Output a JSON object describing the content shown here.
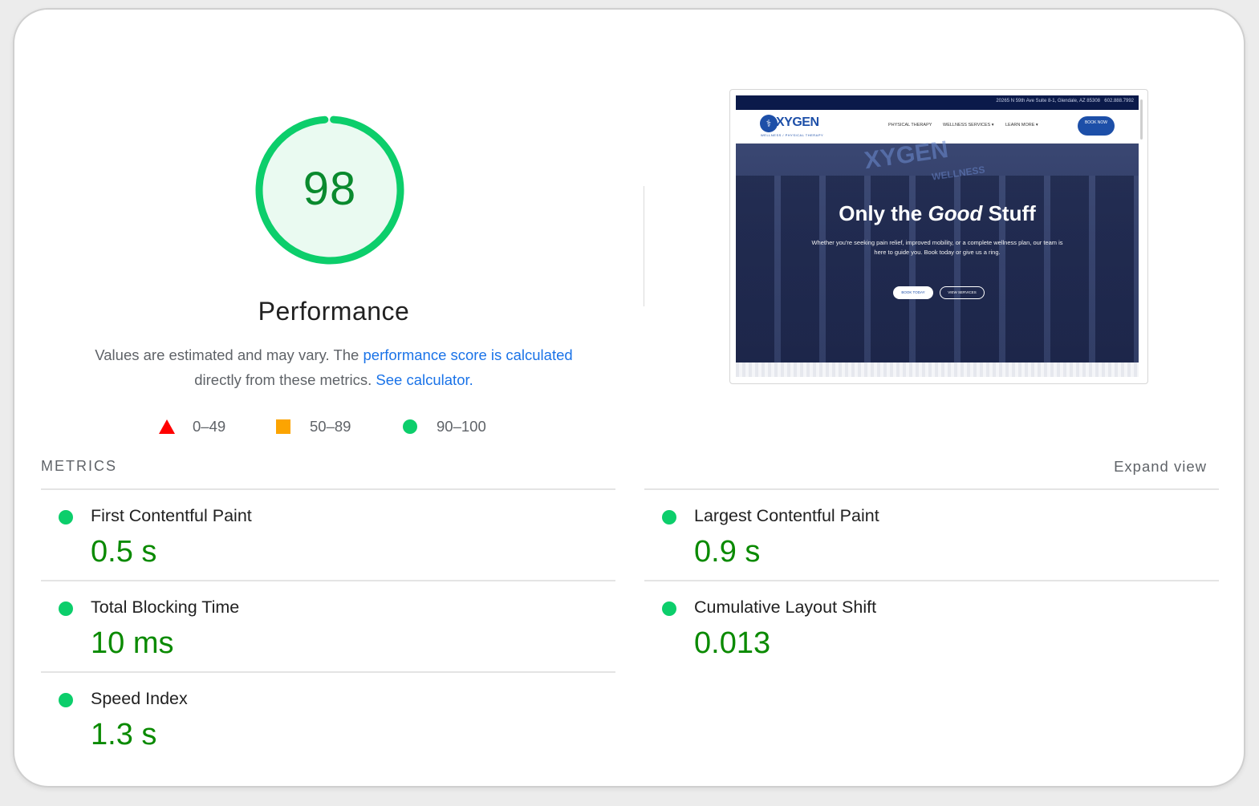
{
  "gauge": {
    "score": "98",
    "score_value": 98,
    "color": "#0cce6b"
  },
  "performance": {
    "title": "Performance",
    "desc_part1": "Values are estimated and may vary. The ",
    "desc_link1": "performance score is calculated",
    "desc_part2": " directly from these metrics. ",
    "desc_link2": "See calculator."
  },
  "legend": [
    {
      "range": "0–49",
      "shape": "triangle",
      "color": "#ff0000"
    },
    {
      "range": "50–89",
      "shape": "square",
      "color": "#fca401"
    },
    {
      "range": "90–100",
      "shape": "circle",
      "color": "#0cce6b"
    }
  ],
  "preview": {
    "topbar_address": "20265 N 59th Ave Suite 8-1, Glendale, AZ 85308",
    "topbar_phone": "602.888.7992",
    "logo_text": "XYGEN",
    "logo_sub": "WELLNESS / PHYSICAL THERAPY",
    "nav": [
      "PHYSICAL THERAPY",
      "WELLNESS SERVICES ▾",
      "LEARN MORE ▾"
    ],
    "book_button": "BOOK NOW",
    "sign": "XYGEN",
    "sign_sub": "WELLNESS",
    "hero_title_part1": "Only the ",
    "hero_title_em": "Good",
    "hero_title_part2": " Stuff",
    "hero_sub": "Whether you're seeking pain relief, improved mobility, or a complete wellness plan, our team is here to guide you. Book today or give us a ring.",
    "hero_btn1": "BOOK TODAY",
    "hero_btn2": "VIEW SERVICES"
  },
  "metrics": {
    "label": "METRICS",
    "expand": "Expand view",
    "items": [
      {
        "name": "First Contentful Paint",
        "value": "0.5 s"
      },
      {
        "name": "Largest Contentful Paint",
        "value": "0.9 s"
      },
      {
        "name": "Total Blocking Time",
        "value": "10 ms"
      },
      {
        "name": "Cumulative Layout Shift",
        "value": "0.013"
      },
      {
        "name": "Speed Index",
        "value": "1.3 s"
      }
    ]
  }
}
